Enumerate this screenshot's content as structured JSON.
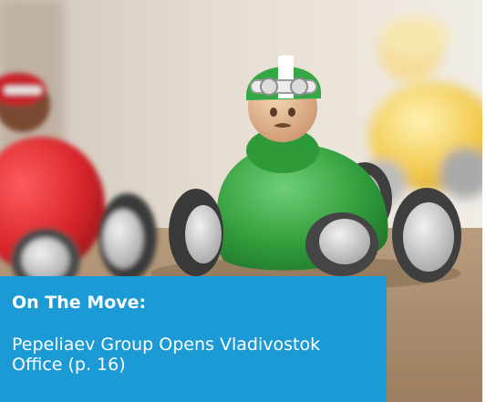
{
  "caption": {
    "title": "On The Move:",
    "body": "Pepeliaev Group Opens Vladivostok Office (p. 16)",
    "background_color": "#1b9ad6",
    "text_color": "#ffffff"
  },
  "photo": {
    "subject": "toy race cars with drivers",
    "car_colors": [
      "#d8262b",
      "#2f9a3a",
      "#f2c94c"
    ]
  }
}
